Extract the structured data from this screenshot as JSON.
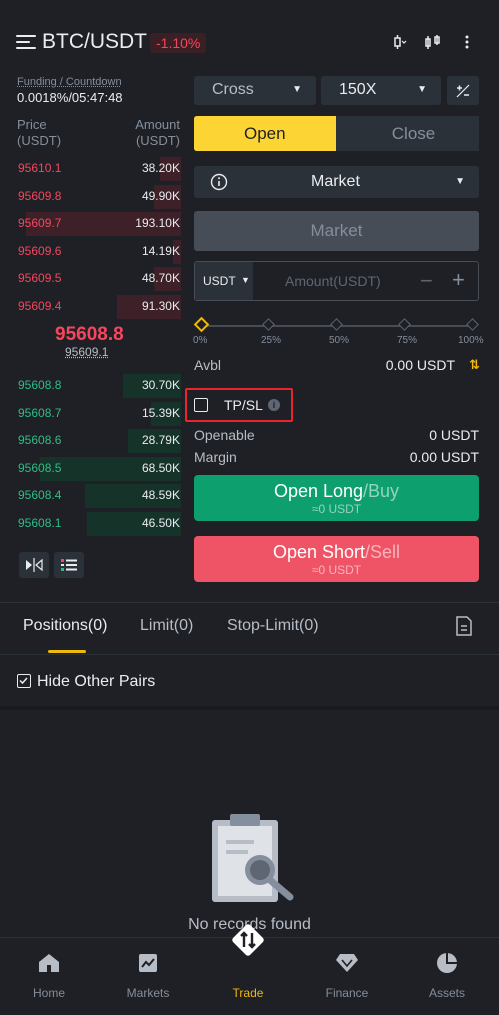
{
  "header": {
    "pair": "BTC/USDT",
    "change": "-1.10%"
  },
  "funding": {
    "label": "Funding / Countdown",
    "value": "0.0018%/05:47:48"
  },
  "orderbook": {
    "price_header": "Price",
    "price_unit": "(USDT)",
    "amount_header": "Amount",
    "amount_unit": "(USDT)",
    "asks": [
      {
        "price": "95610.1",
        "amount": "38.20K",
        "depth": 0.13
      },
      {
        "price": "95609.8",
        "amount": "49.90K",
        "depth": 0.17
      },
      {
        "price": "95609.7",
        "amount": "193.10K",
        "depth": 0.97
      },
      {
        "price": "95609.6",
        "amount": "14.19K",
        "depth": 0.05
      },
      {
        "price": "95609.5",
        "amount": "48.70K",
        "depth": 0.17
      },
      {
        "price": "95609.4",
        "amount": "91.30K",
        "depth": 0.4
      }
    ],
    "mid_price": "95608.8",
    "mark_price": "95609.1",
    "bids": [
      {
        "price": "95608.8",
        "amount": "30.70K",
        "depth": 0.36
      },
      {
        "price": "95608.7",
        "amount": "15.39K",
        "depth": 0.19
      },
      {
        "price": "95608.6",
        "amount": "28.79K",
        "depth": 0.33
      },
      {
        "price": "95608.5",
        "amount": "68.50K",
        "depth": 0.88
      },
      {
        "price": "95608.4",
        "amount": "48.59K",
        "depth": 0.6
      },
      {
        "price": "95608.1",
        "amount": "46.50K",
        "depth": 0.59
      }
    ]
  },
  "controls": {
    "margin_mode": "Cross",
    "leverage": "150X",
    "open_tab": "Open",
    "close_tab": "Close",
    "order_type": "Market",
    "market_price_btn": "Market",
    "currency": "USDT",
    "amount_placeholder": "Amount(USDT)",
    "minus": "−",
    "plus": "+",
    "slider_labels": [
      "0%",
      "25%",
      "50%",
      "75%",
      "100%"
    ],
    "avbl_label": "Avbl",
    "avbl_value": "0.00 USDT",
    "tpsl_label": "TP/SL",
    "openable_label": "Openable",
    "openable_value": "0 USDT",
    "margin_label": "Margin",
    "margin_value": "0.00 USDT",
    "long_main": "Open Long",
    "long_suffix": "/Buy",
    "long_sub": "≈0 USDT",
    "short_main": "Open Short",
    "short_suffix": "/Sell",
    "short_sub": "≈0 USDT"
  },
  "lower_tabs": {
    "positions": "Positions(0)",
    "limit": "Limit(0)",
    "stop_limit": "Stop-Limit(0)",
    "hide_pairs": "Hide Other Pairs",
    "empty": "No records found"
  },
  "nav": {
    "home": "Home",
    "markets": "Markets",
    "trade": "Trade",
    "finance": "Finance",
    "assets": "Assets"
  },
  "colors": {
    "accent": "#f0b90b",
    "buy": "#2ebd85",
    "sell": "#f6465d"
  }
}
